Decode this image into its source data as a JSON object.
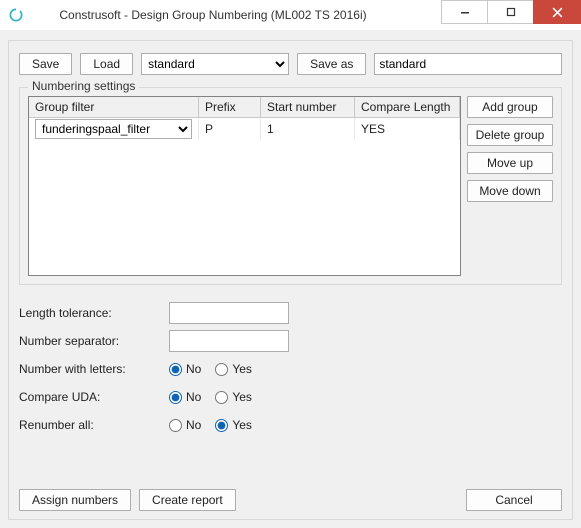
{
  "title": "Construsoft - Design Group Numbering (ML002 TS 2016i)",
  "toolbar": {
    "save": "Save",
    "load": "Load",
    "preset_selected": "standard",
    "save_as": "Save as",
    "preset_name": "standard"
  },
  "group": {
    "title": "Numbering settings",
    "headers": {
      "group_filter": "Group filter",
      "prefix": "Prefix",
      "start_number": "Start number",
      "compare_length": "Compare Length"
    },
    "rows": [
      {
        "group_filter": "funderingspaal_filter",
        "prefix": "P",
        "start_number": "1",
        "compare_length": "YES"
      }
    ],
    "side": {
      "add": "Add group",
      "delete": "Delete group",
      "up": "Move up",
      "down": "Move down"
    }
  },
  "settings": {
    "length_tolerance_label": "Length tolerance:",
    "length_tolerance_value": "",
    "number_separator_label": "Number separator:",
    "number_separator_value": "",
    "number_with_letters_label": "Number with letters:",
    "compare_uda_label": "Compare UDA:",
    "renumber_all_label": "Renumber all:",
    "no": "No",
    "yes": "Yes",
    "number_with_letters": "No",
    "compare_uda": "No",
    "renumber_all": "Yes"
  },
  "footer": {
    "assign": "Assign numbers",
    "report": "Create report",
    "cancel": "Cancel"
  }
}
